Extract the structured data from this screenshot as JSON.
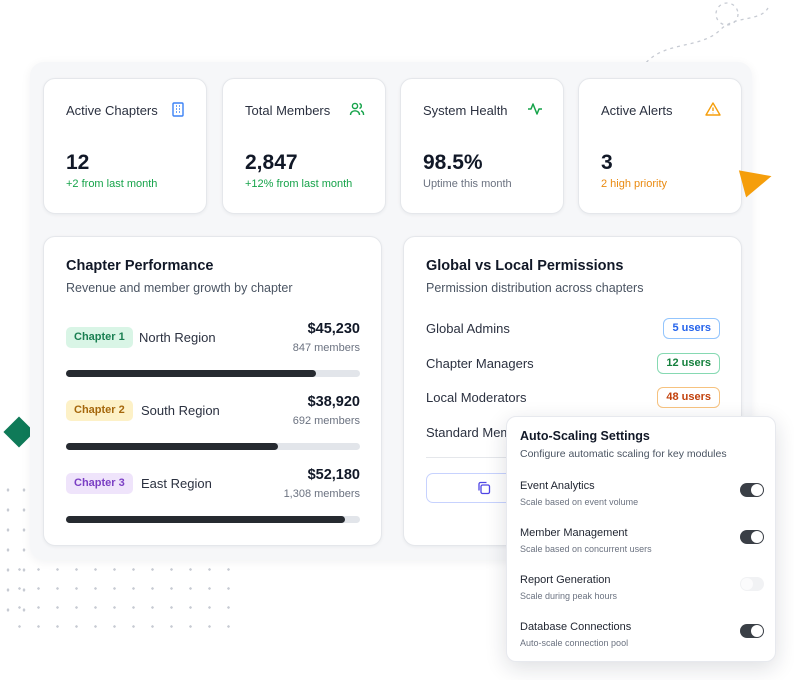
{
  "stats": [
    {
      "label": "Active Chapters",
      "value": "12",
      "sub": "+2 from last month",
      "icon": "building-icon",
      "sub_color": "#16a34a",
      "icon_color": "#3b82f6"
    },
    {
      "label": "Total Members",
      "value": "2,847",
      "sub": "+12% from last month",
      "icon": "users-icon",
      "sub_color": "#16a34a",
      "icon_color": "#16a34a"
    },
    {
      "label": "System Health",
      "value": "98.5%",
      "sub": "Uptime this month",
      "icon": "activity-icon",
      "sub_color": "#6b7280",
      "icon_color": "#16a34a"
    },
    {
      "label": "Active Alerts",
      "value": "3",
      "sub": "2 high priority",
      "icon": "warning-triangle-icon",
      "sub_color": "#ea8a10",
      "icon_color": "#f59e0b"
    }
  ],
  "performance": {
    "title": "Chapter Performance",
    "subtitle": "Revenue and member growth by chapter",
    "chapters": [
      {
        "chip": "Chapter 1",
        "region": "North Region",
        "amount": "$45,230",
        "members": "847 members",
        "progress": 0.85
      },
      {
        "chip": "Chapter 2",
        "region": "South Region",
        "amount": "$38,920",
        "members": "692 members",
        "progress": 0.72
      },
      {
        "chip": "Chapter 3",
        "region": "East Region",
        "amount": "$52,180",
        "members": "1,308 members",
        "progress": 0.95
      }
    ]
  },
  "permissions": {
    "title": "Global vs Local Permissions",
    "subtitle": "Permission distribution across chapters",
    "rows": [
      {
        "label": "Global Admins",
        "count": "5 users"
      },
      {
        "label": "Chapter Managers",
        "count": "12 users"
      },
      {
        "label": "Local Moderators",
        "count": "48 users"
      },
      {
        "label": "Standard Mem",
        "count": ""
      }
    ]
  },
  "autoscaling": {
    "title": "Auto-Scaling Settings",
    "subtitle": "Configure automatic scaling for key modules",
    "settings": [
      {
        "label": "Event Analytics",
        "desc": "Scale based on event volume",
        "enabled": true
      },
      {
        "label": "Member Management",
        "desc": "Scale based on concurrent users",
        "enabled": true
      },
      {
        "label": "Report Generation",
        "desc": "Scale during peak hours",
        "enabled": false
      },
      {
        "label": "Database Connections",
        "desc": "Auto-scale connection pool",
        "enabled": true
      }
    ]
  },
  "colors": {
    "accent_dark": "#262a30",
    "diamond": "#0f7a58",
    "triangle": "#f59e0b"
  }
}
